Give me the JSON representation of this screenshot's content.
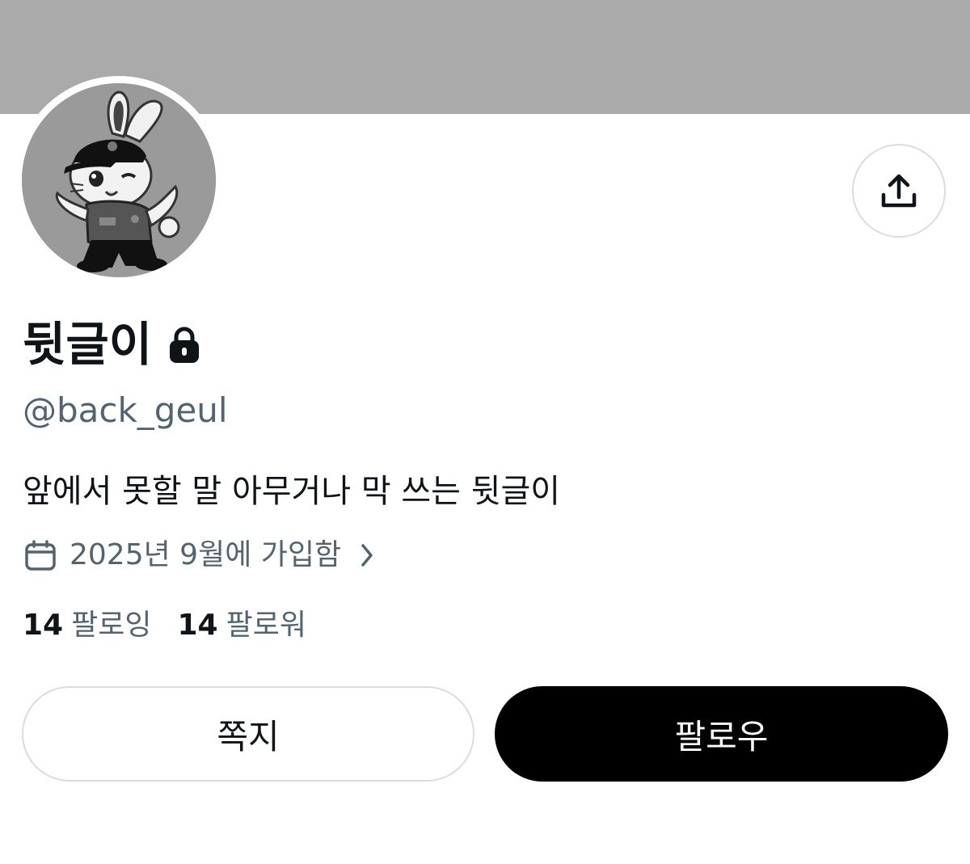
{
  "profile": {
    "display_name": "뒷글이",
    "handle": "@back_geul",
    "bio": "앞에서 못할 말 아무거나 막 쓰는 뒷글이",
    "joined": "2025년 9월에 가입함",
    "protected_icon": "lock-icon",
    "avatar_icon": "rabbit-avatar-image"
  },
  "stats": {
    "following_count": "14",
    "following_label": "팔로잉",
    "followers_count": "14",
    "followers_label": "팔로워"
  },
  "actions": {
    "message_label": "쪽지",
    "follow_label": "팔로우",
    "share_icon": "share-icon"
  },
  "colors": {
    "banner": "#aaaaaa",
    "primary_text": "#0f1419",
    "secondary_text": "#536471",
    "follow_button": "#000000",
    "border": "#dcdcdc"
  }
}
